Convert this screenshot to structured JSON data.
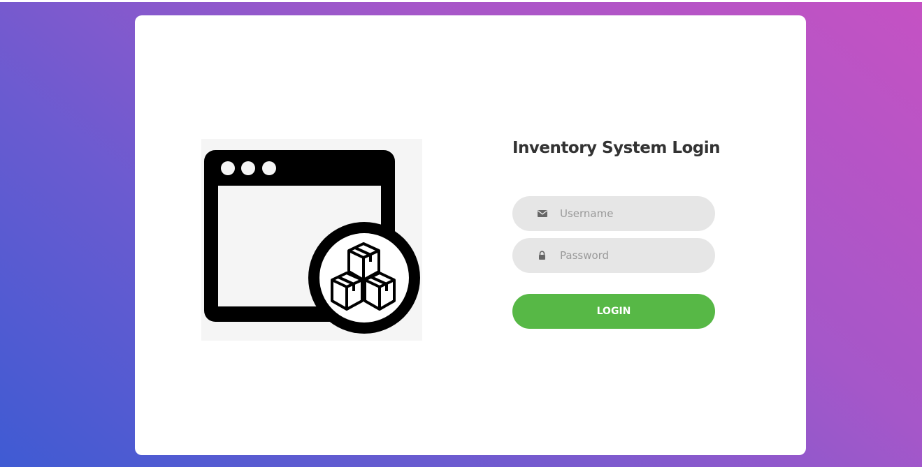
{
  "login": {
    "title": "Inventory System Login",
    "username": {
      "placeholder": "Username",
      "value": "",
      "icon": "envelope-icon"
    },
    "password": {
      "placeholder": "Password",
      "value": "",
      "icon": "lock-icon"
    },
    "submit_label": "LOGIN"
  },
  "illustration": {
    "icon": "inventory-window-boxes-icon"
  },
  "colors": {
    "background_gradient": [
      "#3f5bd3",
      "#c552c3"
    ],
    "card": "#ffffff",
    "input_bg": "#e6e6e6",
    "button": "#57b846",
    "title_text": "#333333"
  }
}
